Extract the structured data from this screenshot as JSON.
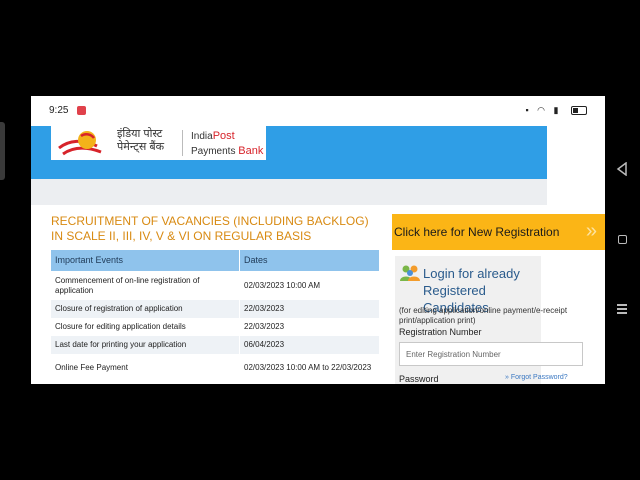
{
  "status": {
    "time": "9:25"
  },
  "logo": {
    "hindi_line1": "इंडिया पोस्ट",
    "hindi_line2": "पेमेन्ट्स बैंक",
    "en_line1_a": "India",
    "en_line1_b": "Post",
    "en_line2_a": "Payments",
    "en_line2_b": "Bank"
  },
  "recruitment": {
    "title": "RECRUITMENT OF VACANCIES (INCLUDING BACKLOG) IN SCALE II, III, IV, V & VI ON REGULAR BASIS"
  },
  "events_table": {
    "headers": [
      "Important Events",
      "Dates"
    ],
    "rows": [
      {
        "event": "Commencement of on-line registration of application",
        "date": "02/03/2023 10:00 AM"
      },
      {
        "event": "Closure of registration of application",
        "date": "22/03/2023"
      },
      {
        "event": "Closure for editing application details",
        "date": "22/03/2023"
      },
      {
        "event": "Last date for printing your application",
        "date": "06/04/2023"
      },
      {
        "event": "Online Fee Payment",
        "date": "02/03/2023 10:00 AM to 22/03/2023"
      }
    ]
  },
  "registration": {
    "button_label": "Click here for New Registration"
  },
  "login": {
    "title_line1": "Login for already",
    "title_line2": "Registered Candidates",
    "note": "(for editing application/online payment/e-receipt print/application print)",
    "reg_no_label": "Registration Number",
    "reg_no_placeholder": "Enter Registration Number",
    "password_label": "Password",
    "forgot_label": "Forgot Password?"
  },
  "colors": {
    "accent_blue": "#2f9ee6",
    "cta_yellow": "#fbb516",
    "title_orange": "#d88a12",
    "header_blue": "#8fc3ec"
  },
  "icons": [
    "record-icon",
    "wifi-icon",
    "signal-icon",
    "battery-icon",
    "people-icon",
    "chevron-right-icon",
    "nav-back-icon",
    "nav-home-icon",
    "nav-recents-icon"
  ]
}
